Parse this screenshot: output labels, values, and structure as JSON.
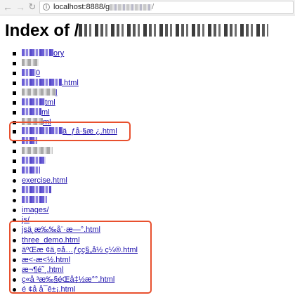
{
  "browser": {
    "url_host": "localhost:8888/g",
    "url_tail": "/"
  },
  "page": {
    "title": "Index of /"
  },
  "files": [
    {
      "label": "ory",
      "blur_width": 45
    },
    {
      "label": "",
      "blur_width": 24
    },
    {
      "label": "0",
      "blur_width": 20
    },
    {
      "label": ".html",
      "blur_width": 57
    },
    {
      "label": "l",
      "blur_width": 48
    },
    {
      "label": "tml",
      "blur_width": 33
    },
    {
      "label": "ml",
      "blur_width": 28
    },
    {
      "label": "ml",
      "blur_width": 30
    },
    {
      "label": "ä_ƒå·§æ ¿.html",
      "blur_width": 58
    },
    {
      "label": "",
      "blur_width": 22
    },
    {
      "label": "",
      "blur_width": 44
    },
    {
      "label": "",
      "blur_width": 34
    },
    {
      "label": "",
      "blur_width": 26
    },
    {
      "label": "exercise.html",
      "blur_width": 0
    },
    {
      "label": "",
      "blur_width": 42
    },
    {
      "label": "",
      "blur_width": 36
    },
    {
      "label": "images/",
      "blur_width": 0
    },
    {
      "label": "js/",
      "blur_width": 0
    },
    {
      "label": "jsä¸­æ‰‰å¨·æ—°.html",
      "blur_width": 0
    },
    {
      "label": "three_demo.html",
      "blur_width": 0
    },
    {
      "label": "äºŒæ ¢ä¸¤å…ƒçç§„å½ ç¼®.html",
      "blur_width": 0
    },
    {
      "label": "æ<-æ<½.html",
      "blur_width": 0
    },
    {
      "label": "æ¬¶é˜¸.html",
      "blur_width": 0
    },
    {
      "label": "ç«å ³æ‰§éŒå‡½æ°°.html",
      "blur_width": 0
    },
    {
      "label": "é ¢å å¯ê±¡.html",
      "blur_width": 0
    }
  ]
}
